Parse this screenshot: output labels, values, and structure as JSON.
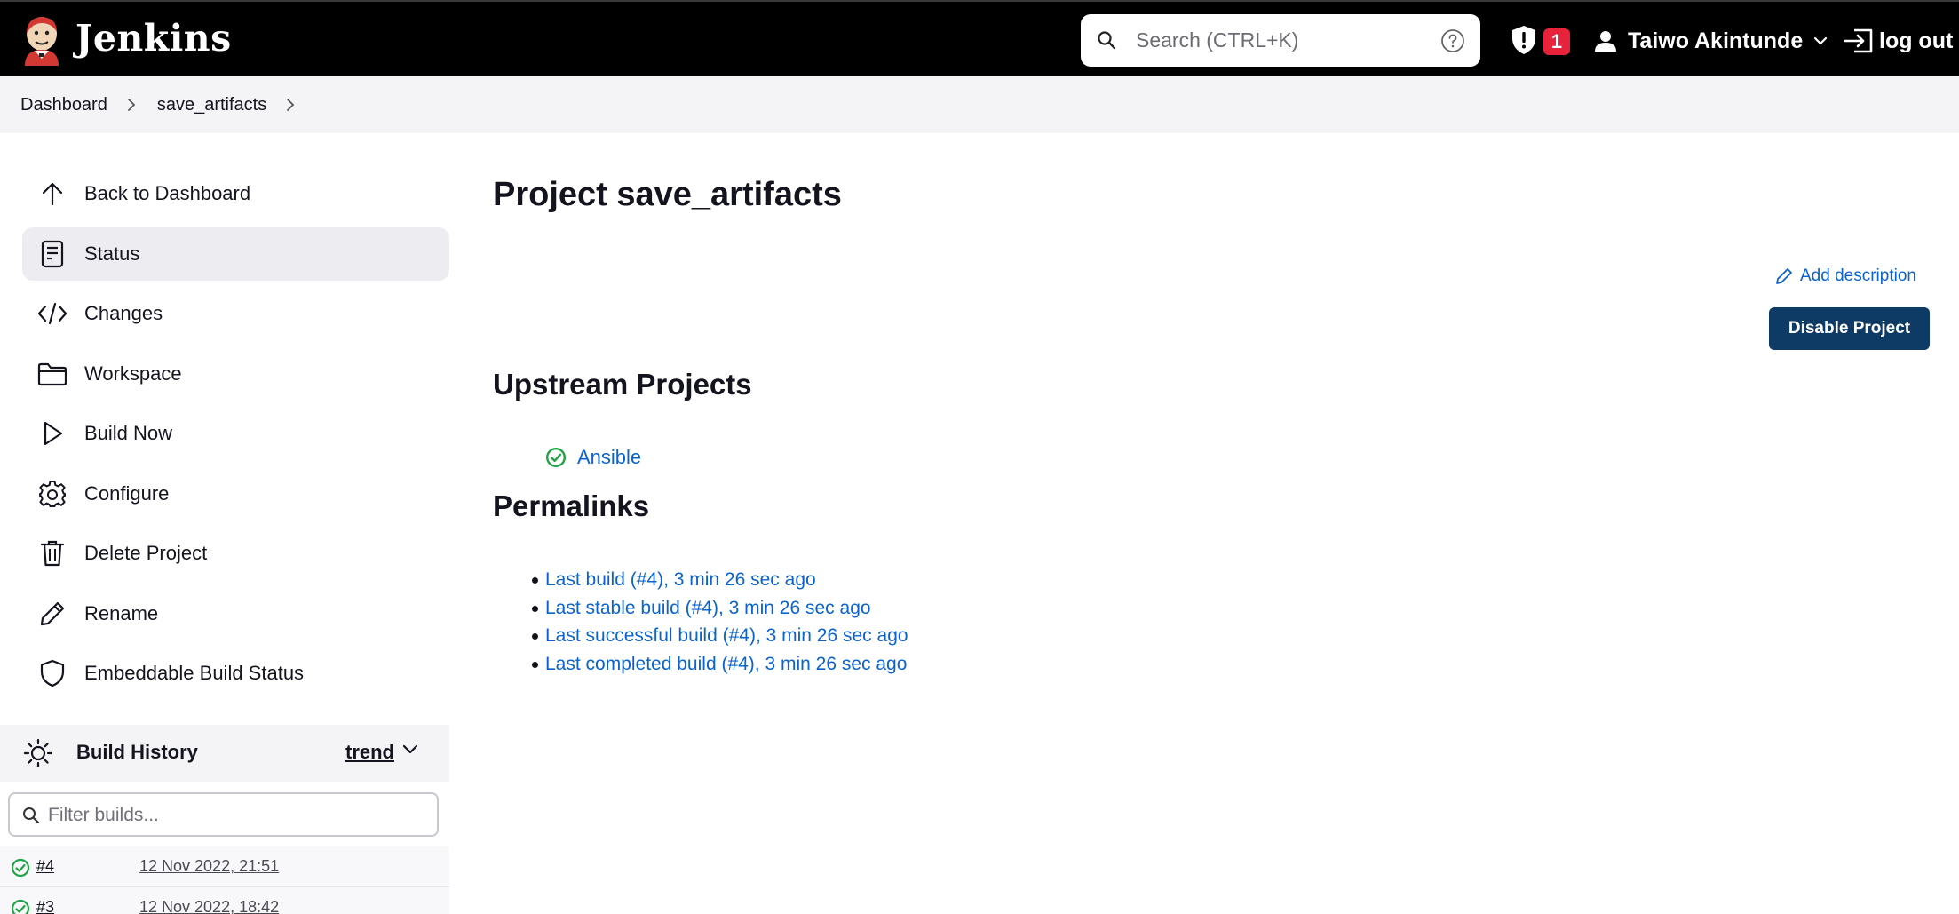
{
  "header": {
    "brand": "Jenkins",
    "search_placeholder": "Search (CTRL+K)",
    "security_count": "1",
    "user_name": "Taiwo Akintunde",
    "logout_label": "log out"
  },
  "breadcrumb": {
    "items": [
      "Dashboard",
      "save_artifacts"
    ]
  },
  "sidebar": {
    "items": [
      {
        "label": "Back to Dashboard",
        "icon": "arrow-up-icon"
      },
      {
        "label": "Status",
        "icon": "document-icon"
      },
      {
        "label": "Changes",
        "icon": "code-icon"
      },
      {
        "label": "Workspace",
        "icon": "folder-icon"
      },
      {
        "label": "Build Now",
        "icon": "play-icon"
      },
      {
        "label": "Configure",
        "icon": "gear-icon"
      },
      {
        "label": "Delete Project",
        "icon": "trash-icon"
      },
      {
        "label": "Rename",
        "icon": "pencil-icon"
      },
      {
        "label": "Embeddable Build Status",
        "icon": "shield-icon"
      }
    ],
    "active_item": "Status"
  },
  "build_history": {
    "title": "Build History",
    "trend_label": "trend",
    "filter_placeholder": "Filter builds...",
    "builds": [
      {
        "number": "#4",
        "date": "12 Nov 2022, 21:51",
        "status": "success"
      },
      {
        "number": "#3",
        "date": "12 Nov 2022, 18:42",
        "status": "success"
      }
    ]
  },
  "main": {
    "title": "Project save_artifacts",
    "add_description": "Add description",
    "disable_button": "Disable Project",
    "upstream_heading": "Upstream Projects",
    "upstream_projects": [
      {
        "name": "Ansible",
        "status": "success"
      }
    ],
    "permalinks_heading": "Permalinks",
    "permalinks": [
      "Last build (#4), 3 min 26 sec ago",
      "Last stable build (#4), 3 min 26 sec ago",
      "Last successful build (#4), 3 min 26 sec ago",
      "Last completed build (#4), 3 min 26 sec ago"
    ]
  },
  "colors": {
    "header_bg": "#000000",
    "link": "#0b63ce",
    "primary_button": "#0e3b66",
    "success": "#1ea446",
    "badge": "#e6233b"
  }
}
